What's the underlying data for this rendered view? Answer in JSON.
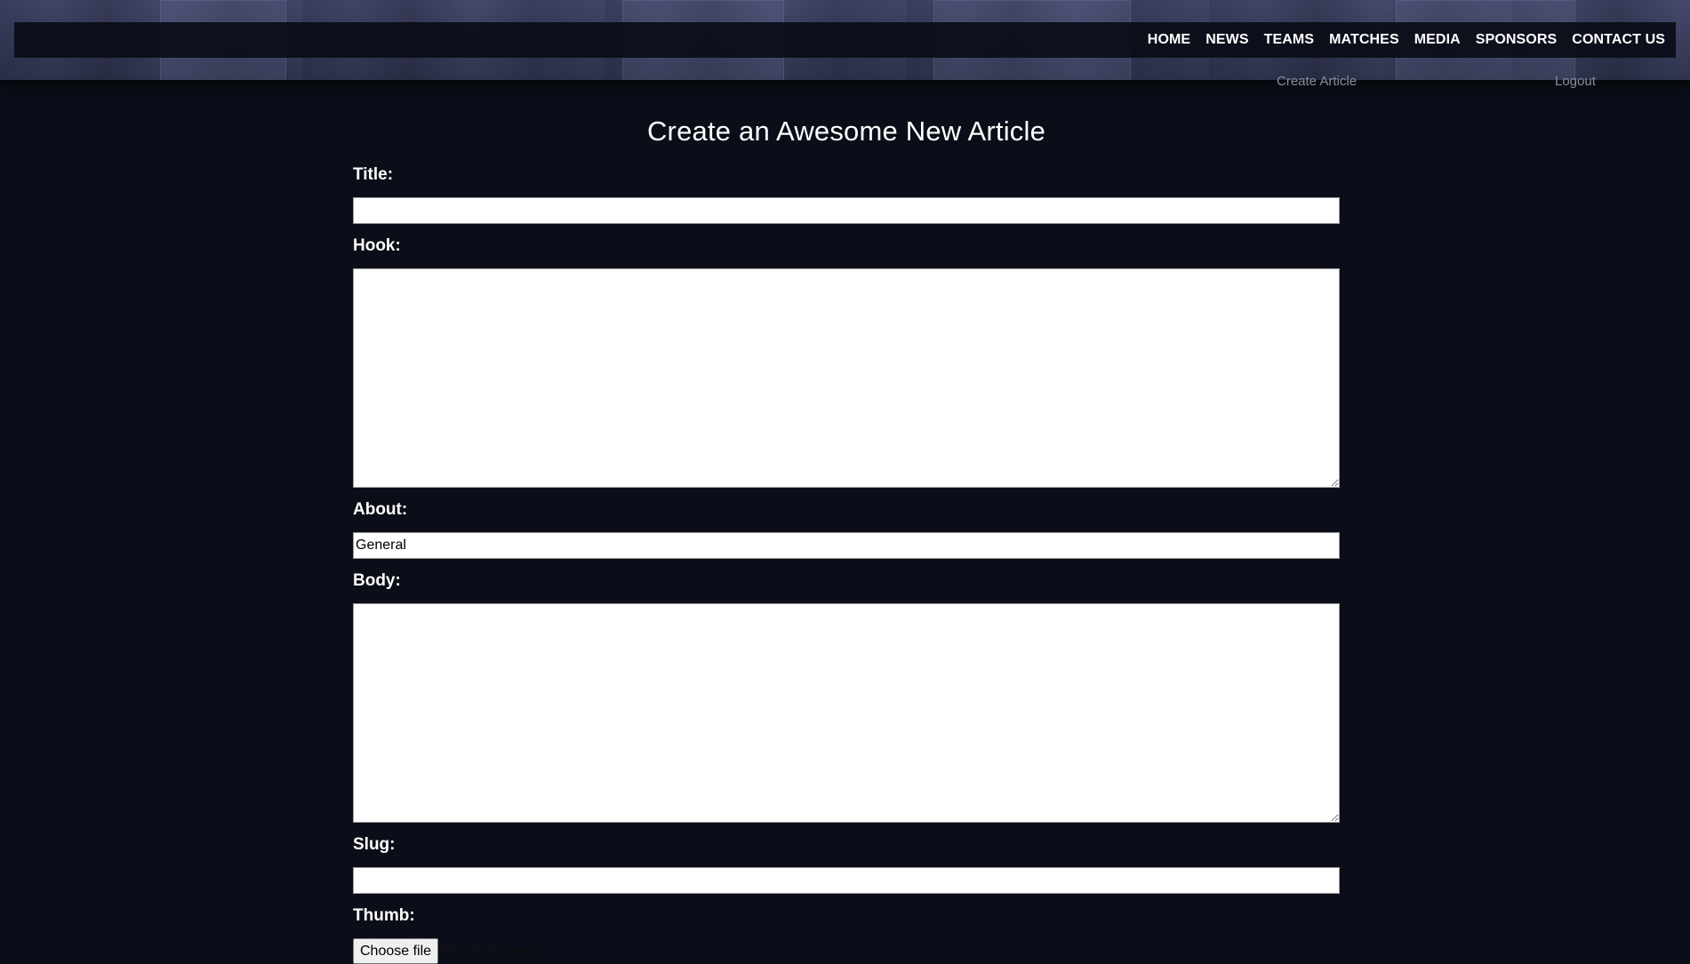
{
  "nav": {
    "items": [
      "HOME",
      "NEWS",
      "TEAMS",
      "MATCHES",
      "MEDIA",
      "SPONSORS",
      "CONTACT US"
    ]
  },
  "subnav": {
    "create_article": "Create Article",
    "logout": "Logout"
  },
  "form": {
    "heading": "Create an Awesome New Article",
    "title_label": "Title:",
    "title_value": "",
    "hook_label": "Hook:",
    "hook_value": "",
    "about_label": "About:",
    "about_value": "General",
    "body_label": "Body:",
    "body_value": "",
    "slug_label": "Slug:",
    "slug_value": "",
    "thumb_label": "Thumb:",
    "thumb_button": "Choose file",
    "thumb_status": "No file chosen"
  },
  "colors": {
    "background": "#0b0e18",
    "navbar": "#0a0c16",
    "text": "#ffffff",
    "muted": "#8a8d99"
  }
}
